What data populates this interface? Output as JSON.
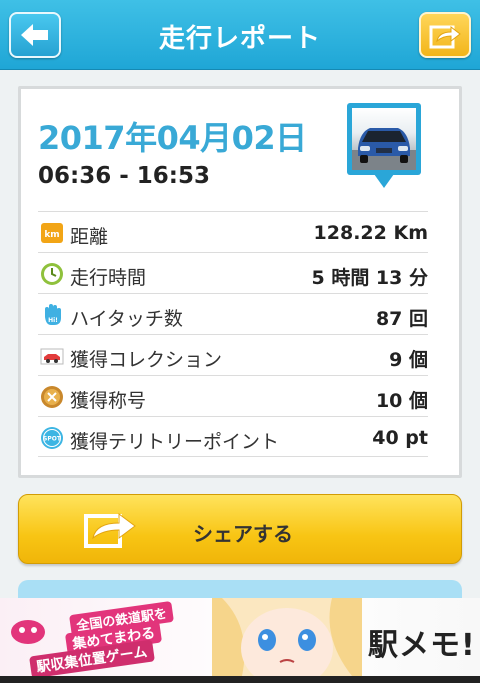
{
  "header": {
    "title": "走行レポート"
  },
  "report": {
    "date": "2017年04月02日",
    "time_range": "06:36 - 16:53",
    "stats": [
      {
        "icon": "km-icon",
        "label": "距離",
        "value": "128.22 Km"
      },
      {
        "icon": "clock-icon",
        "label": "走行時間",
        "value": "5 時間 13 分"
      },
      {
        "icon": "hand-icon",
        "label": "ハイタッチ数",
        "value": "87 回"
      },
      {
        "icon": "car-icon",
        "label": "獲得コレクション",
        "value": "9 個"
      },
      {
        "icon": "medal-icon",
        "label": "獲得称号",
        "value": "10 個"
      },
      {
        "icon": "spot-icon",
        "label": "獲得テリトリーポイント",
        "value": "40 pt"
      }
    ]
  },
  "share": {
    "label": "シェアする"
  },
  "ad": {
    "line1": "全国の鉄道駅を",
    "line2": "集めてまわる",
    "line3": "駅収集位置ゲーム",
    "logo": "駅メモ!"
  },
  "colors": {
    "header": "#1fa6d6",
    "accent": "#39a9d6",
    "share_button": "#f8c514"
  }
}
